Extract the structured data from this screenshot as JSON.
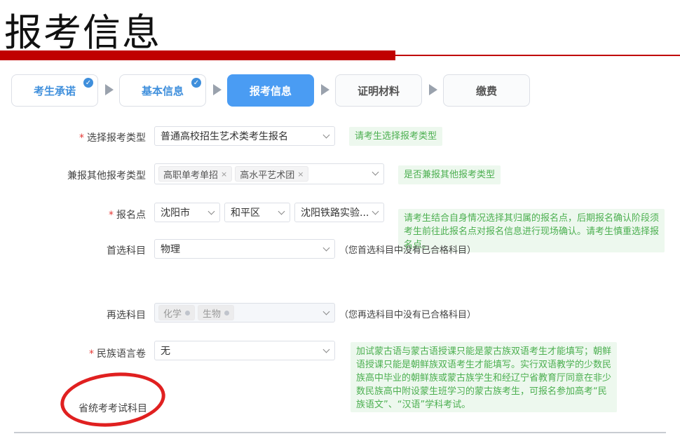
{
  "page_title": "报考信息",
  "steps": [
    {
      "label": "考生承诺",
      "status": "done"
    },
    {
      "label": "基本信息",
      "status": "done"
    },
    {
      "label": "报考信息",
      "status": "active"
    },
    {
      "label": "证明材料",
      "status": "todo"
    },
    {
      "label": "缴费",
      "status": "todo"
    }
  ],
  "form": {
    "exam_type": {
      "label": "选择报考类型",
      "required": "*",
      "value": "普通高校招生艺术类考生报名",
      "hint": "请考生选择报考类型"
    },
    "other_types": {
      "label": "兼报其他报考类型",
      "tags": [
        "高职单考单招",
        "高水平艺术团"
      ],
      "tag_remove": "×",
      "hint": "是否兼报其他报考类型"
    },
    "location": {
      "label": "报名点",
      "required": "*",
      "city": "沈阳市",
      "district": "和平区",
      "site": "沈阳铁路实验...",
      "hint": "请考生结合自身情况选择其归属的报名点，后期报名确认阶段须考生前往此报名点对报名信息进行现场确认。请考生慎重选择报名点。"
    },
    "first_subject": {
      "label": "首选科目",
      "value": "物理",
      "note": "（您首选科目中没有已合格科目）"
    },
    "second_subject": {
      "label": "再选科目",
      "tags": [
        "化学",
        "生物"
      ],
      "note": "（您再选科目中没有已合格科目）"
    },
    "ethnic_language": {
      "label": "民族语言卷",
      "required": "*",
      "value": "无",
      "hint": "加试蒙古语与蒙古语授课只能是蒙古族双语考生才能填写；朝鲜语授课只能是朝鲜族双语考生才能填写。实行双语教学的少数民族高中毕业的朝鲜族或蒙古族学生和经辽宁省教育厅同意在非少数民族高中附设蒙生班学习的蒙古族考生，可报名参加高考“民族语文”、“汉语”学科考试。"
    },
    "provincial_subject": {
      "label": "省统考考试科目"
    }
  },
  "colors": {
    "accent_red": "#c00000",
    "step_active": "#4a9cf3",
    "hint_bg": "#edf8ee",
    "hint_text": "#4caf50",
    "annotation": "#e02020"
  }
}
